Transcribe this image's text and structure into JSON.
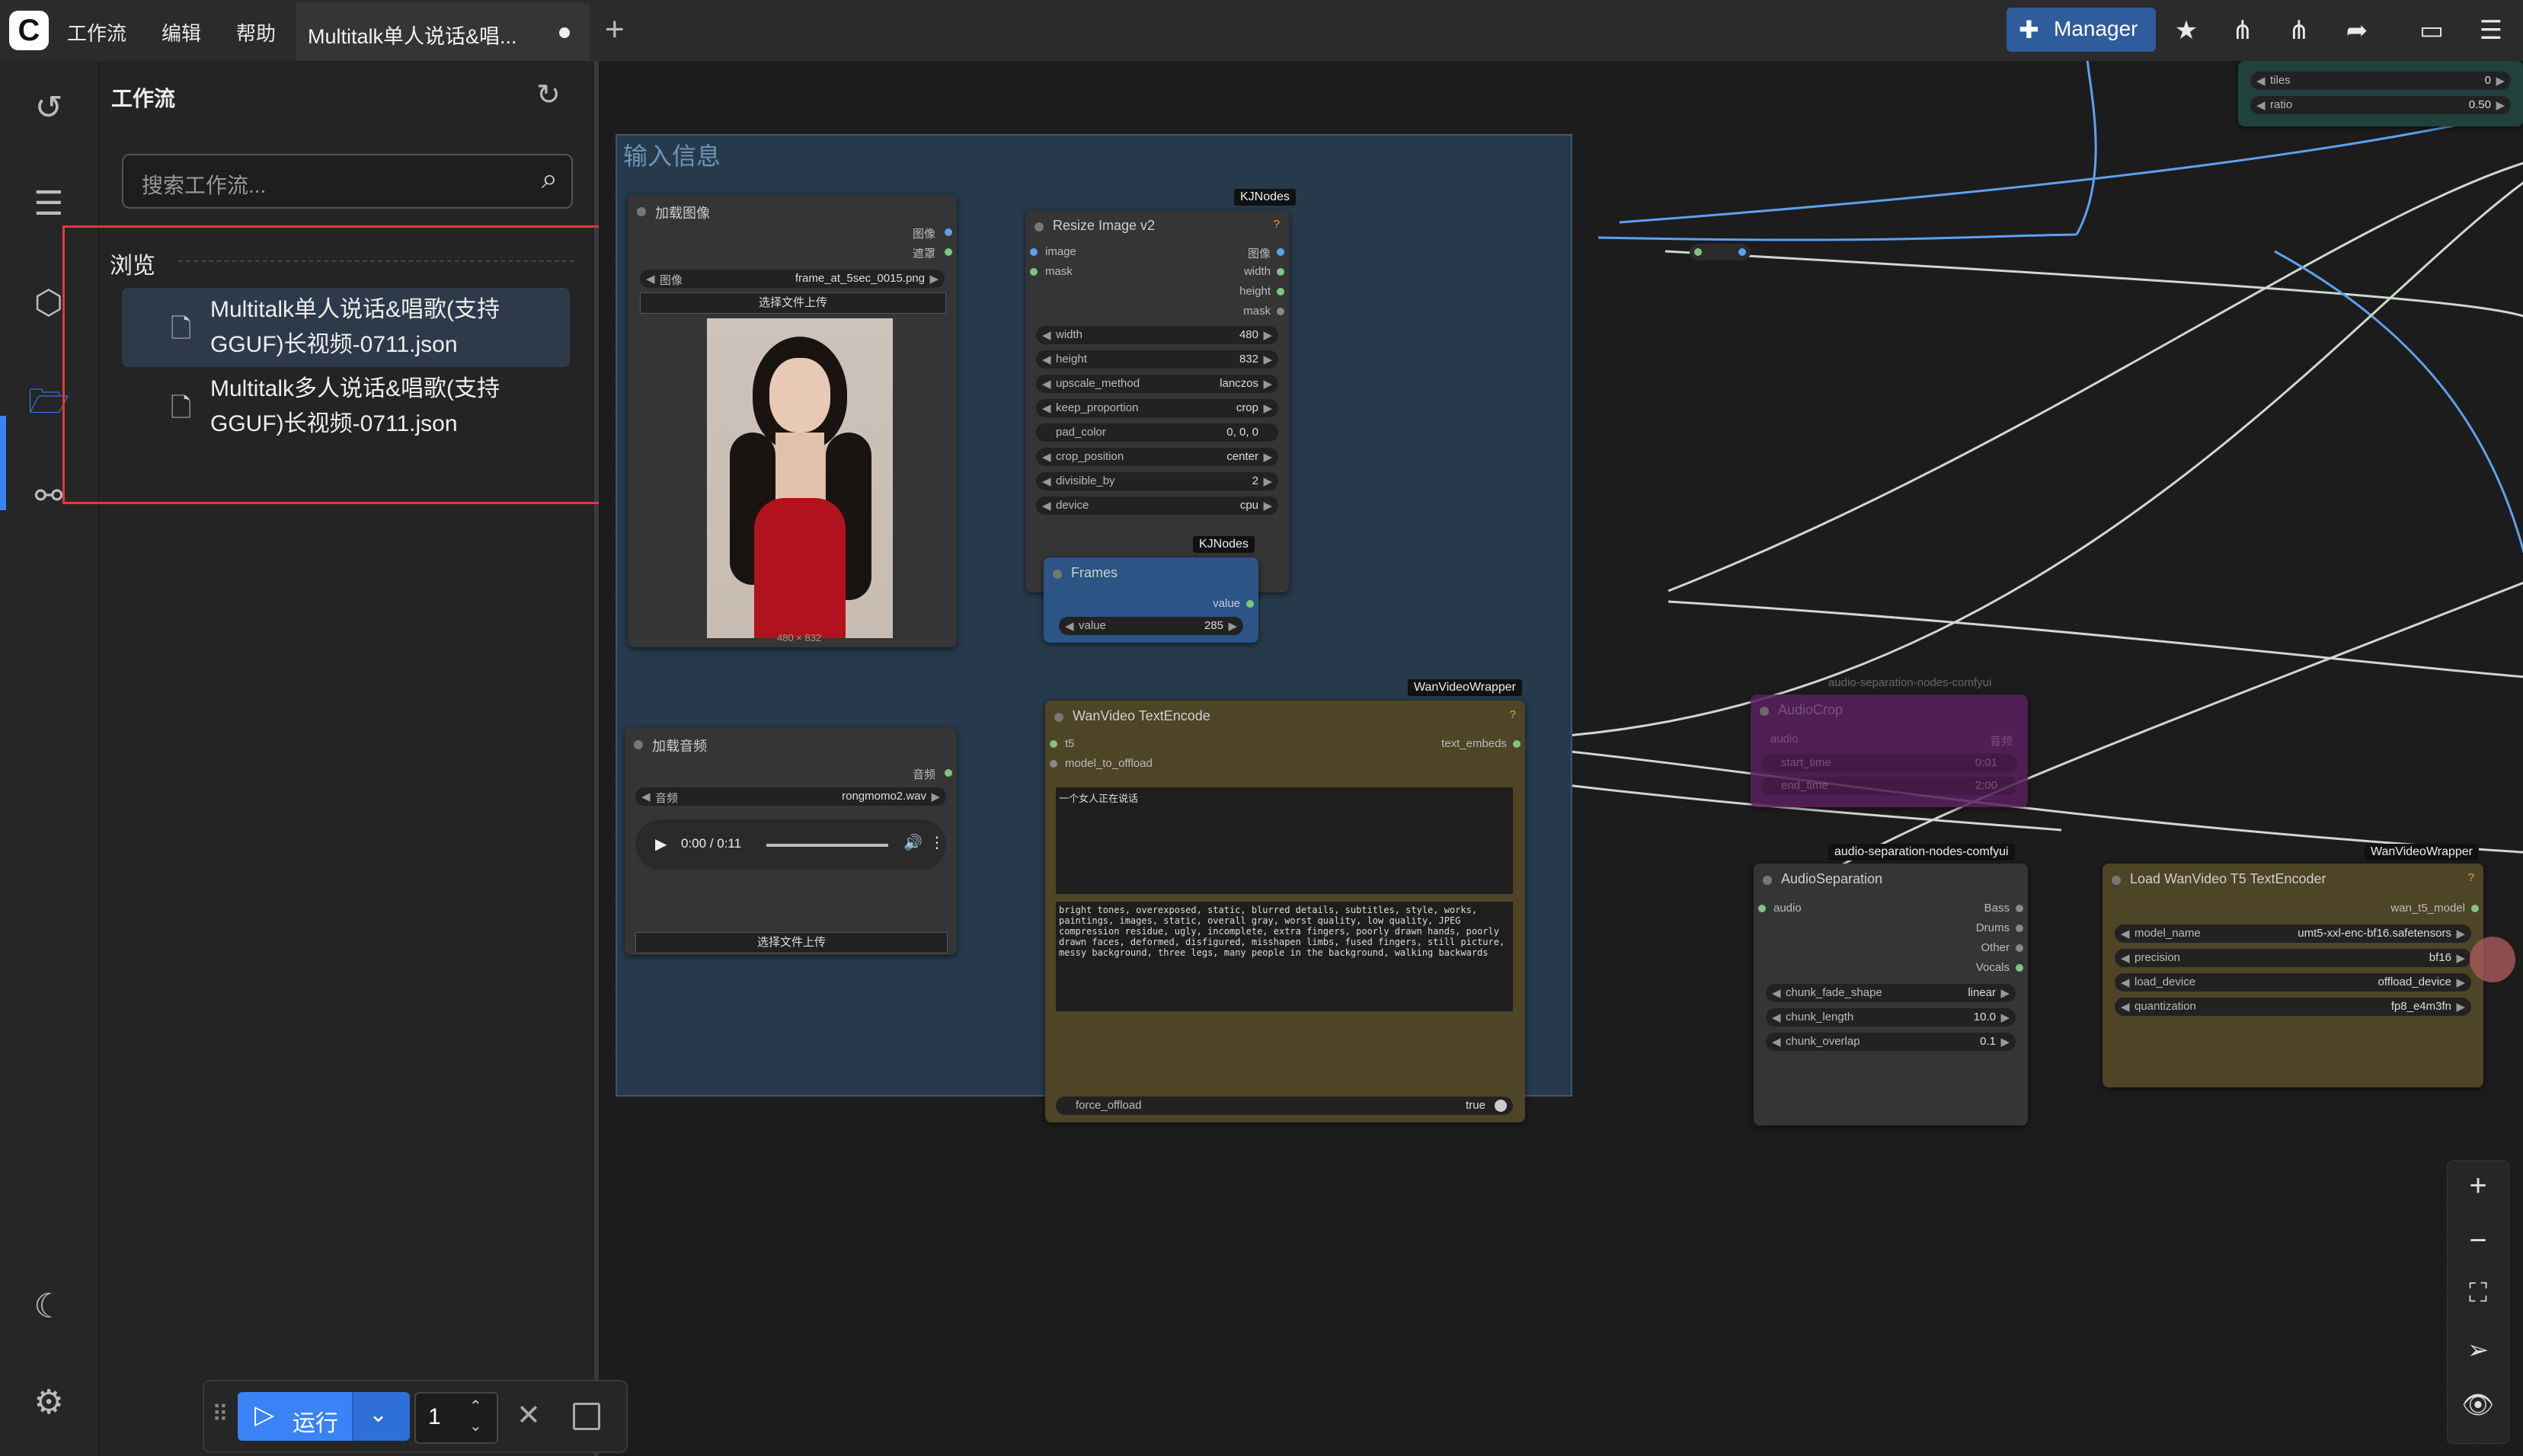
{
  "topbar": {
    "logo": "C",
    "menu": [
      "工作流",
      "编辑",
      "帮助"
    ],
    "tab_title": "Multitalk单人说话&唱...",
    "manager_label": "Manager"
  },
  "sidebar": {
    "title": "工作流",
    "search_placeholder": "搜索工作流...",
    "browse_label": "浏览",
    "files": [
      "Multitalk单人说话&唱歌(支持GGUF)长视频-0711.json",
      "Multitalk多人说话&唱歌(支持GGUF)长视频-0711.json"
    ]
  },
  "canvas": {
    "group_title": "输入信息",
    "load_image": {
      "title": "加载图像",
      "out1": "图像",
      "out2": "遮罩",
      "image_label": "图像",
      "image_value": "frame_at_5sec_0015.png",
      "upload": "选择文件上传",
      "size": "480 × 832"
    },
    "resize": {
      "badge": "KJNodes",
      "title": "Resize Image v2",
      "help": "?",
      "inputs": [
        "image",
        "mask"
      ],
      "outputs": [
        "图像",
        "width",
        "height",
        "mask"
      ],
      "widgets": [
        {
          "label": "width",
          "value": "480"
        },
        {
          "label": "height",
          "value": "832"
        },
        {
          "label": "upscale_method",
          "value": "lanczos"
        },
        {
          "label": "keep_proportion",
          "value": "crop"
        },
        {
          "label": "pad_color",
          "value": "0, 0, 0"
        },
        {
          "label": "crop_position",
          "value": "center"
        },
        {
          "label": "divisible_by",
          "value": "2"
        },
        {
          "label": "device",
          "value": "cpu"
        }
      ]
    },
    "frames": {
      "badge": "KJNodes",
      "title": "Frames",
      "out": "value",
      "label": "value",
      "value": "285"
    },
    "load_audio": {
      "title": "加载音频",
      "out": "音频",
      "label": "音频",
      "value": "rongmomo2.wav",
      "time": "0:00 / 0:11",
      "upload": "选择文件上传"
    },
    "text_encode": {
      "badge": "WanVideoWrapper",
      "title": "WanVideo TextEncode",
      "help": "?",
      "inputs": [
        "t5",
        "model_to_offload"
      ],
      "output": "text_embeds",
      "positive": "一个女人正在说话",
      "negative": "bright tones, overexposed, static, blurred details, subtitles, style, works, paintings, images, static, overall gray, worst quality, low quality, JPEG compression residue, ugly, incomplete, extra fingers, poorly drawn hands, poorly drawn faces, deformed, disfigured, misshapen limbs, fused fingers, still picture, messy background, three legs, many people in the background, walking backwards",
      "toggle_label": "force_offload",
      "toggle_value": "true"
    },
    "audio_crop": {
      "badge": "audio-separation-nodes-comfyui",
      "title": "AudioCrop",
      "in": "audio",
      "out": "音频",
      "rows": [
        {
          "label": "start_time",
          "value": "0:01"
        },
        {
          "label": "end_time",
          "value": "2:00"
        }
      ]
    },
    "audio_sep": {
      "badge": "audio-separation-nodes-comfyui",
      "title": "AudioSeparation",
      "in": "audio",
      "outputs": [
        "Bass",
        "Drums",
        "Other",
        "Vocals"
      ],
      "widgets": [
        {
          "label": "chunk_fade_shape",
          "value": "linear"
        },
        {
          "label": "chunk_length",
          "value": "10.0"
        },
        {
          "label": "chunk_overlap",
          "value": "0.1"
        }
      ]
    },
    "t5_loader": {
      "badge": "WanVideoWrapper",
      "title": "Load WanVideo T5 TextEncoder",
      "help": "?",
      "out": "wan_t5_model",
      "widgets": [
        {
          "label": "model_name",
          "value": "umt5-xxl-enc-bf16.safetensors"
        },
        {
          "label": "precision",
          "value": "bf16"
        },
        {
          "label": "load_device",
          "value": "offload_device"
        },
        {
          "label": "quantization",
          "value": "fp8_e4m3fn"
        }
      ]
    },
    "topright_node": {
      "rows": [
        {
          "label": "tiles",
          "value": "0"
        },
        {
          "label": "ratio",
          "value": "0.50"
        }
      ]
    }
  },
  "runbar": {
    "run_label": "运行",
    "count": "1"
  },
  "colors": {
    "accent": "#3b82f6",
    "manager": "#2f5c9d",
    "highlight": "#e53935"
  }
}
